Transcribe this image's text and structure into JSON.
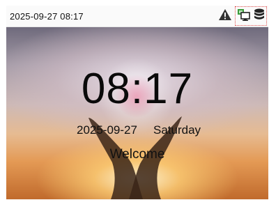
{
  "status_bar": {
    "datetime": "2025-09-27 08:17",
    "icons": [
      "warning-icon",
      "network-icon",
      "database-icon"
    ]
  },
  "main": {
    "time": "08:17",
    "date": "2025-09-27",
    "weekday": "Saturday",
    "welcome": "Welcome"
  },
  "colors": {
    "network_green": "#3a9a3a",
    "highlight_border": "#e05050"
  }
}
